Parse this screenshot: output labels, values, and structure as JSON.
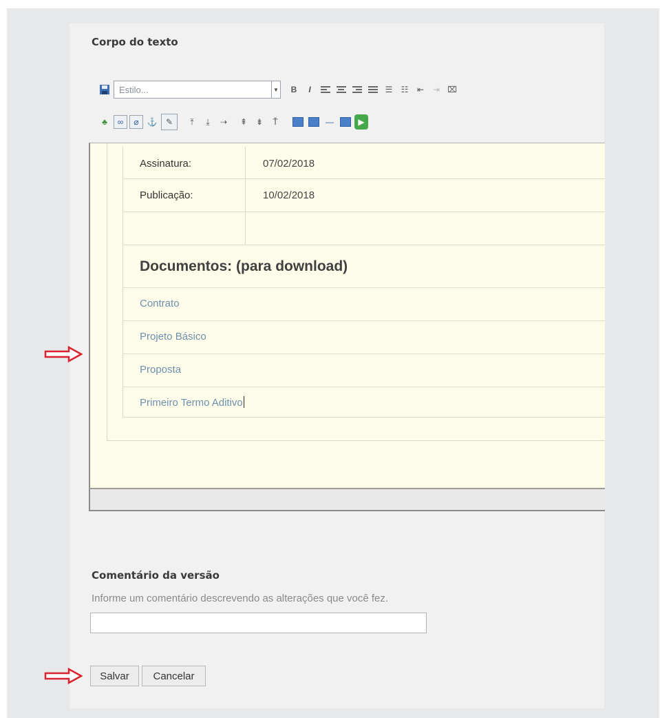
{
  "editor_section": {
    "title": "Corpo do texto",
    "style_select": {
      "placeholder": "Estilo..."
    }
  },
  "toolbar": {
    "row1_icons": [
      "save-icon",
      "bold-icon",
      "italic-icon",
      "align-left-icon",
      "align-center-icon",
      "align-right-icon",
      "align-justify-icon",
      "bulleted-list-icon",
      "numbered-list-icon",
      "outdent-icon",
      "indent-icon",
      "clear-format-icon"
    ],
    "row2_icons": [
      "image-icon",
      "link-icon",
      "unlink-icon",
      "anchor-icon",
      "edit-table-icon",
      "insert-row-above-icon",
      "insert-row-below-icon",
      "delete-row-icon",
      "insert-column-left-icon",
      "insert-column-right-icon",
      "delete-column-icon",
      "table-icon",
      "table-properties-icon",
      "horizontal-rule-icon",
      "media-icon",
      "play-icon"
    ],
    "bold_glyph": "B",
    "italic_glyph": "I"
  },
  "document": {
    "rows": [
      {
        "label": "Assinatura:",
        "value": "07/02/2018"
      },
      {
        "label": "Publicação:",
        "value": "10/02/2018"
      }
    ],
    "downloads_heading": "Documentos: (para download)",
    "links": [
      "Contrato",
      "Projeto Básico",
      "Proposta",
      "Primeiro Termo Aditivo"
    ]
  },
  "comment_section": {
    "title": "Comentário da versão",
    "hint": "Informe um comentário descrevendo as alterações que você fez.",
    "input_value": ""
  },
  "actions": {
    "save_label": "Salvar",
    "cancel_label": "Cancelar"
  },
  "colors": {
    "editor_background": "#fefde9",
    "link": "#6f8fae",
    "annotation_arrow": "#d9232e"
  }
}
